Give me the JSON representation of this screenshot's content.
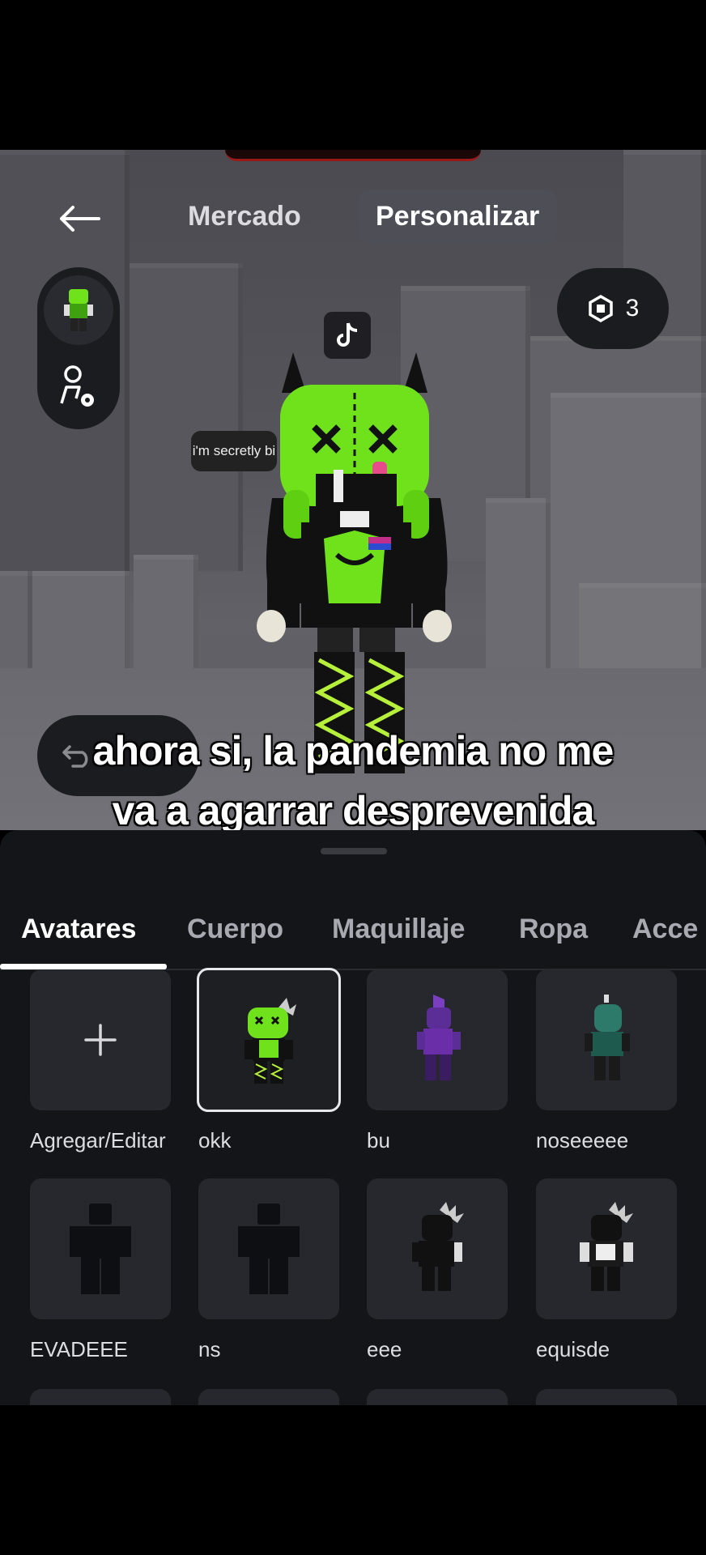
{
  "header": {
    "back_label": "back",
    "tabs": [
      {
        "label": "Mercado",
        "active": false
      },
      {
        "label": "Personalizar",
        "active": true
      }
    ]
  },
  "robux": {
    "icon": "robux-icon",
    "count": "3"
  },
  "scene": {
    "speech_bubble": "i'm secretly bi",
    "caption_line1": "ahora si, la pandemia no me",
    "caption_line2": "va a agarrar desprevenida"
  },
  "sheet": {
    "tabs": [
      "Avatares",
      "Cuerpo",
      "Maquillaje",
      "Ropa",
      "Acce"
    ],
    "active_tab": "Avatares",
    "avatars": [
      {
        "label": "Agregar/Editar",
        "kind": "add"
      },
      {
        "label": "okk",
        "kind": "green",
        "selected": true
      },
      {
        "label": "bu",
        "kind": "purple"
      },
      {
        "label": "noseeeee",
        "kind": "teal"
      },
      {
        "label": "EVADEEE",
        "kind": "blank"
      },
      {
        "label": "ns",
        "kind": "blank"
      },
      {
        "label": "eee",
        "kind": "black"
      },
      {
        "label": "equisde",
        "kind": "black-white"
      }
    ]
  },
  "colors": {
    "accent_green": "#6fe21c",
    "sheet_bg": "#141519",
    "tile_bg": "#27282d"
  }
}
